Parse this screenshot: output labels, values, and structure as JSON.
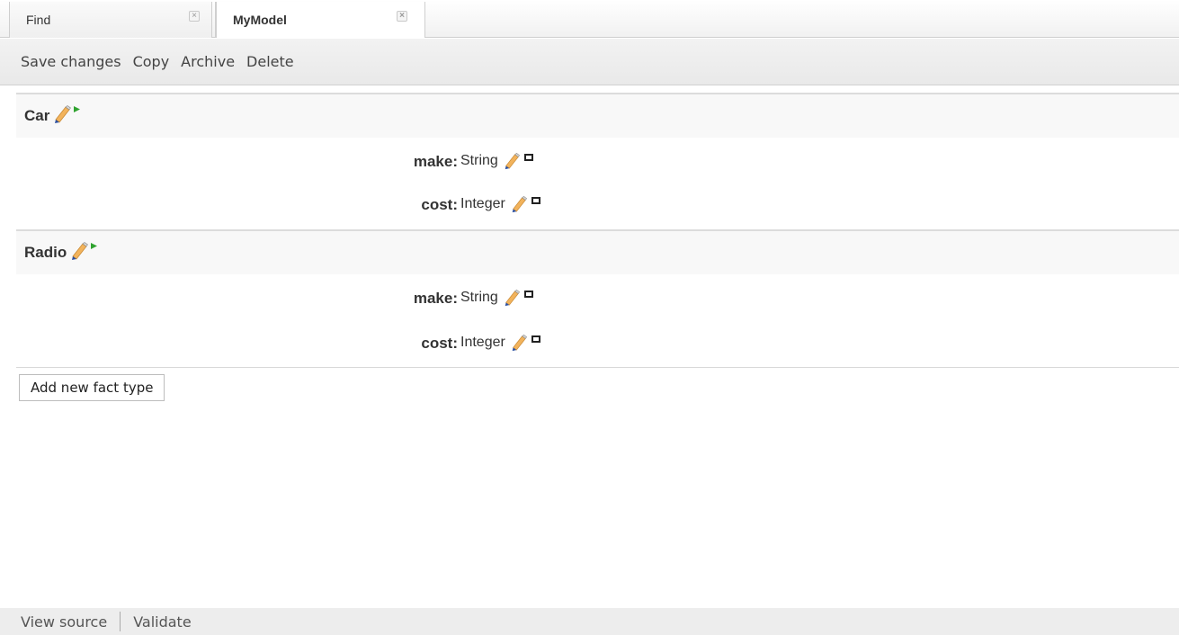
{
  "tabs": [
    {
      "label": "Find",
      "close": "×"
    },
    {
      "label": "MyModel",
      "close": "×"
    }
  ],
  "toolbar": {
    "items": [
      "Save changes",
      "Copy",
      "Archive",
      "Delete"
    ]
  },
  "fact_types": [
    {
      "name": "Car",
      "fields": [
        {
          "name": "make:",
          "type": "String"
        },
        {
          "name": "cost:",
          "type": "Integer"
        }
      ]
    },
    {
      "name": "Radio",
      "fields": [
        {
          "name": "make:",
          "type": "String"
        },
        {
          "name": "cost:",
          "type": "Integer"
        }
      ]
    }
  ],
  "add_fact_button": "Add new fact type",
  "footer": {
    "items": [
      "View source",
      "Validate"
    ]
  },
  "icons": {
    "edit": "pencil-icon",
    "expand": "green-arrow-icon",
    "remove": "remove-field-icon"
  },
  "colors": {
    "pencil": "#e8a048",
    "arrow": "#2fa32f"
  }
}
